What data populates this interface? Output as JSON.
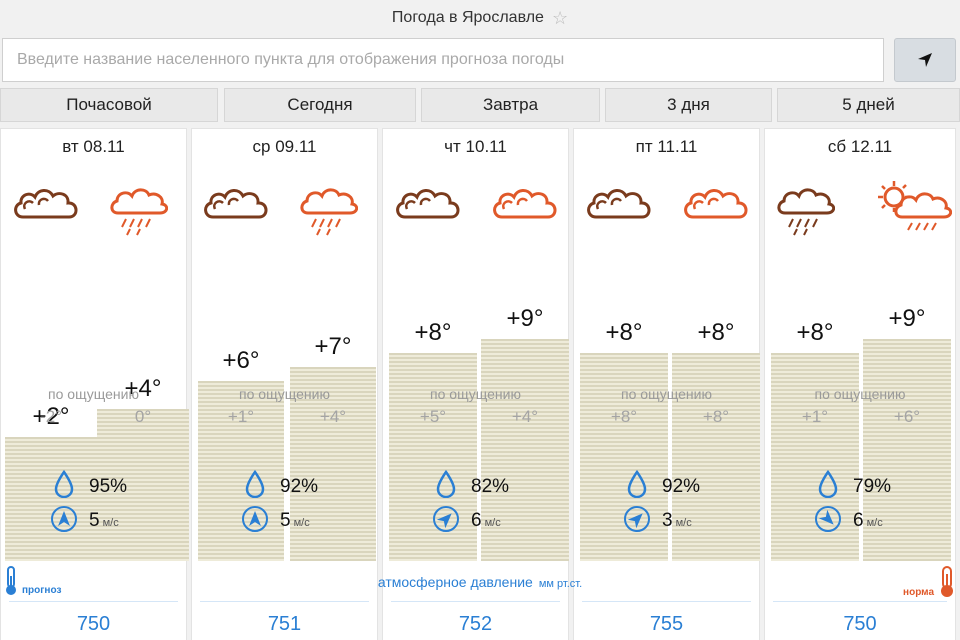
{
  "header": {
    "title": "Погода в Ярославле"
  },
  "search": {
    "placeholder": "Введите название населенного пункта для отображения прогноза погоды"
  },
  "tabs": [
    "Почасовой",
    "Сегодня",
    "Завтра",
    "3 дня",
    "5 дней"
  ],
  "feels_label": "по ощущению",
  "wind_unit": "м/с",
  "pressure_title": "атмосферное давление",
  "pressure_unit": "мм рт.ст.",
  "legend": {
    "forecast": "прогноз",
    "norm": "норма"
  },
  "colors": {
    "accent": "#2a7fd4",
    "cloud_dark": "#7a3b1d",
    "cloud_orange": "#e0592a",
    "norm": "#e0592a"
  },
  "days": [
    {
      "date": "вт 08.11",
      "icons": [
        "cloudy-icon",
        "rain-icon"
      ],
      "t1": "+2°",
      "t2": "+4°",
      "f1": "-2°",
      "f2": "0°",
      "humidity": "95%",
      "wind": "5",
      "pressure": "750"
    },
    {
      "date": "ср 09.11",
      "icons": [
        "cloudy-icon",
        "rain-icon"
      ],
      "t1": "+6°",
      "t2": "+7°",
      "f1": "+1°",
      "f2": "+4°",
      "humidity": "92%",
      "wind": "5",
      "pressure": "751"
    },
    {
      "date": "чт 10.11",
      "icons": [
        "cloudy-icon",
        "cloudy-icon"
      ],
      "t1": "+8°",
      "t2": "+9°",
      "f1": "+5°",
      "f2": "+4°",
      "humidity": "82%",
      "wind": "6",
      "pressure": "752"
    },
    {
      "date": "пт 11.11",
      "icons": [
        "cloudy-icon",
        "cloudy-icon"
      ],
      "t1": "+8°",
      "t2": "+8°",
      "f1": "+8°",
      "f2": "+8°",
      "humidity": "92%",
      "wind": "3",
      "pressure": "755"
    },
    {
      "date": "сб 12.11",
      "icons": [
        "rain-icon",
        "sun-rain-icon"
      ],
      "t1": "+8°",
      "t2": "+9°",
      "f1": "+1°",
      "f2": "+6°",
      "humidity": "79%",
      "wind": "6",
      "pressure": "750"
    }
  ]
}
